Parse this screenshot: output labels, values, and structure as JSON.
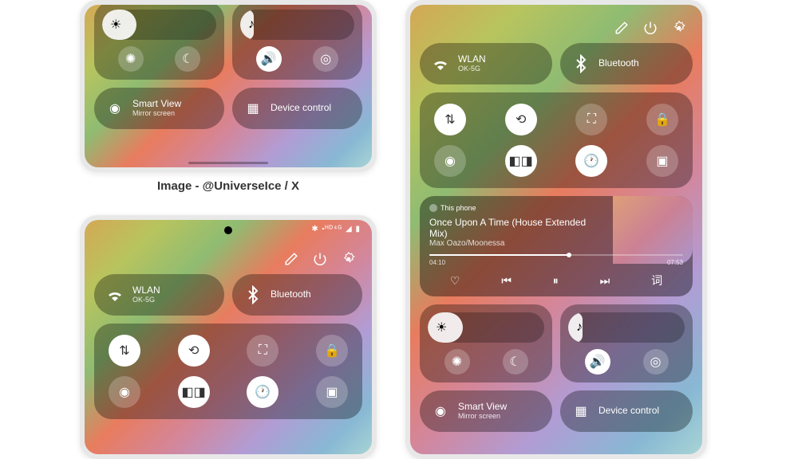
{
  "credit": "Image - @UniverseIce / X",
  "status_icons": "✱ ⬝ᴴᴰ⁴ᴳ ◢ ▮",
  "toolbar": {
    "edit": "edit",
    "power": "power",
    "settings": "settings"
  },
  "wlan": {
    "title": "WLAN",
    "sub": "OK-5G"
  },
  "bluetooth": {
    "title": "Bluetooth"
  },
  "toggles": {
    "r1": [
      "data-swap",
      "sync",
      "screenshot",
      "lock"
    ],
    "r2": [
      "location",
      "dolby",
      "clock",
      "multiwin"
    ]
  },
  "music": {
    "source": "This phone",
    "title": "Once Upon A Time (House Extended Mix)",
    "artist": "Max Oazo/Moonessa",
    "time_cur": "04:10",
    "time_end": "07:53",
    "ctrl_heart": "♡",
    "ctrl_prev": "⏮",
    "ctrl_play": "⏸",
    "ctrl_next": "⏭",
    "ctrl_lyric": "词"
  },
  "brightness": {
    "btn1": "auto-brightness",
    "btn2": "night"
  },
  "volume": {
    "btn1": "sound",
    "btn2": "vibrate"
  },
  "smartview": {
    "title": "Smart View",
    "sub": "Mirror screen"
  },
  "devicectrl": {
    "title": "Device control"
  }
}
